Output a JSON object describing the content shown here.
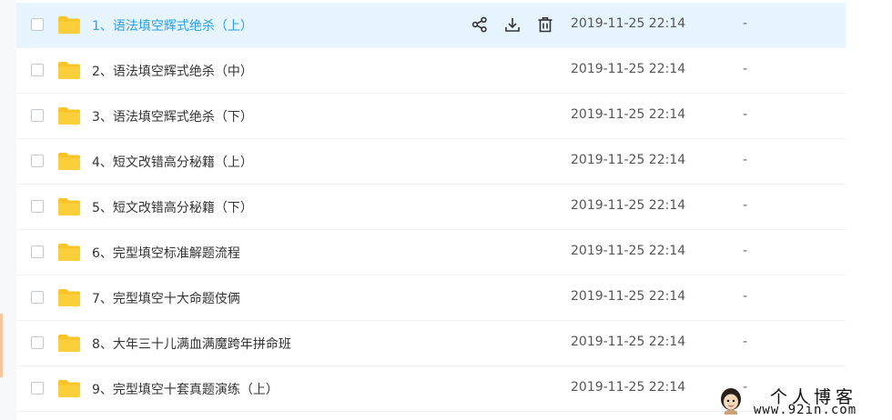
{
  "files": [
    {
      "name": "1、语法填空辉式绝杀（上）",
      "date": "2019-11-25 22:14",
      "size": "-",
      "selected": true
    },
    {
      "name": "2、语法填空辉式绝杀（中）",
      "date": "2019-11-25 22:14",
      "size": "-"
    },
    {
      "name": "3、语法填空辉式绝杀（下）",
      "date": "2019-11-25 22:14",
      "size": "-"
    },
    {
      "name": "4、短文改错高分秘籍（上）",
      "date": "2019-11-25 22:14",
      "size": "-"
    },
    {
      "name": "5、短文改错高分秘籍（下）",
      "date": "2019-11-25 22:14",
      "size": "-"
    },
    {
      "name": "6、完型填空标准解题流程",
      "date": "2019-11-25 22:14",
      "size": "-"
    },
    {
      "name": "7、完型填空十大命题伎俩",
      "date": "2019-11-25 22:14",
      "size": "-"
    },
    {
      "name": "8、大年三十儿满血满魔跨年拼命班",
      "date": "2019-11-25 22:14",
      "size": "-"
    },
    {
      "name": "9、完型填空十套真题演练（上）",
      "date": "2019-11-25 22:14",
      "size": "-"
    }
  ],
  "row_actions": [
    {
      "icon": "share-icon"
    },
    {
      "icon": "download-icon"
    },
    {
      "icon": "trash-icon"
    }
  ],
  "colors": {
    "selected_row_bg": "#e6f4fd",
    "selected_text": "#2a9ee8",
    "folder": "#f8c42a"
  },
  "watermark": {
    "title": "个人博客",
    "url": "www.92in.com"
  }
}
